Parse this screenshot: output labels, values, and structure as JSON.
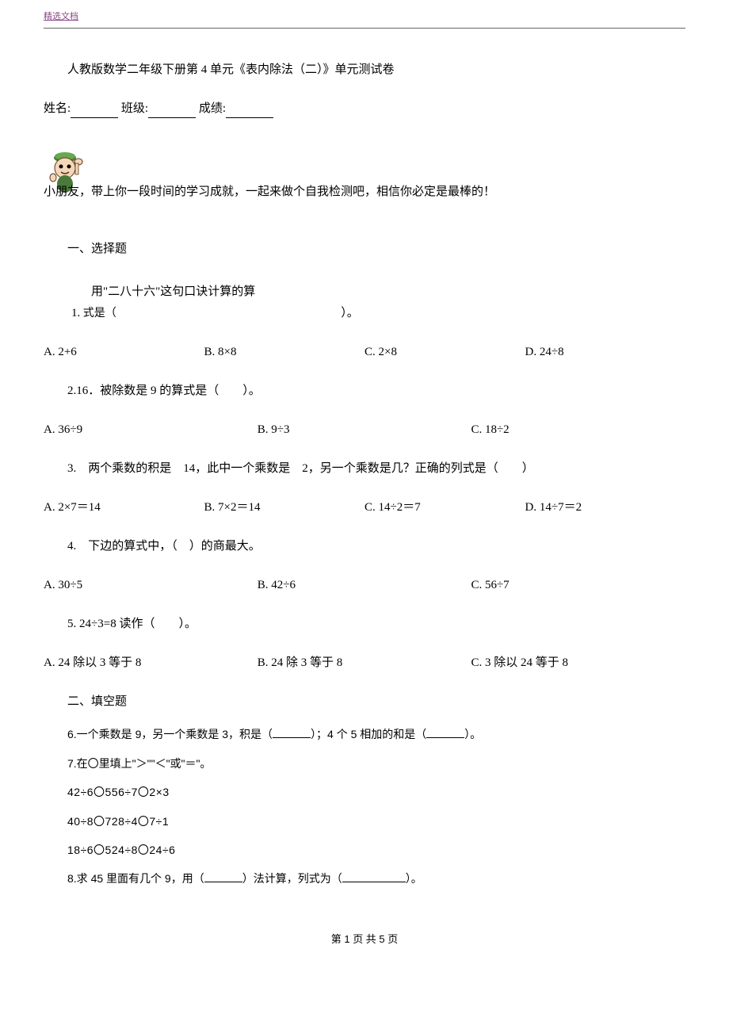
{
  "header_tag": "精选文档",
  "title": "人教版数学二年级下册第 4 单元《表内除法（二）》单元测试卷",
  "info": {
    "name_label": "姓名:",
    "class_label": "班级:",
    "score_label": "成绩:"
  },
  "intro": "小朋友，带上你一段时间的学习成就，一起来做个自我检测吧，相信你必定是最棒的！",
  "section1_heading": "一、选择题",
  "q1": {
    "phrase": "用\"二八十六\"这句口诀计算的算",
    "num_label": "1.",
    "stem_tail": "式是（",
    "suffix": "）。",
    "opts": {
      "a": "A. 2+6",
      "b": "B. 8×8",
      "c": "C. 2×8",
      "d": "D. 24÷8"
    }
  },
  "q2": {
    "text": "2.16．被除数是 9 的算式是（　　）。",
    "opts": {
      "a": "A. 36÷9",
      "b": "B. 9÷3",
      "c": "C. 18÷2"
    }
  },
  "q3": {
    "text": "3.　两个乘数的积是　14，此中一个乘数是　2，另一个乘数是几？正确的列式是（　　）",
    "opts": {
      "a": "A. 2×7＝14",
      "b": "B. 7×2＝14",
      "c": "C. 14÷2＝7",
      "d": "D. 14÷7＝2"
    }
  },
  "q4": {
    "text": "4.　下边的算式中，（　）的商最大。",
    "opts": {
      "a": "A. 30÷5",
      "b": "B. 42÷6",
      "c": "C. 56÷7"
    }
  },
  "q5": {
    "text": "5. 24÷3=8 读作（　　）。",
    "opts": {
      "a": "A. 24 除以 3 等于 8",
      "b": "B. 24 除 3 等于 8",
      "c": "C. 3 除以 24 等于 8"
    }
  },
  "section2_heading": "二、填空题",
  "q6": {
    "prefix": "6.一个乘数是 9，另一个乘数是 3，积是（",
    "mid": "）；4 个 5 相加的和是（",
    "suffix": "）。"
  },
  "q7": "7.在〇里填上\"＞\"\"＜\"或\"＝\"。",
  "q7_lines": [
    "42÷6〇556÷7〇2×3",
    "40÷8〇728÷4〇7÷1",
    "18÷6〇524÷8〇24÷6"
  ],
  "q8": {
    "prefix": "8.求 45 里面有几个 9，用（",
    "mid": "）法计算，列式为（",
    "suffix": "）。"
  },
  "footer": "第 1 页 共 5 页"
}
